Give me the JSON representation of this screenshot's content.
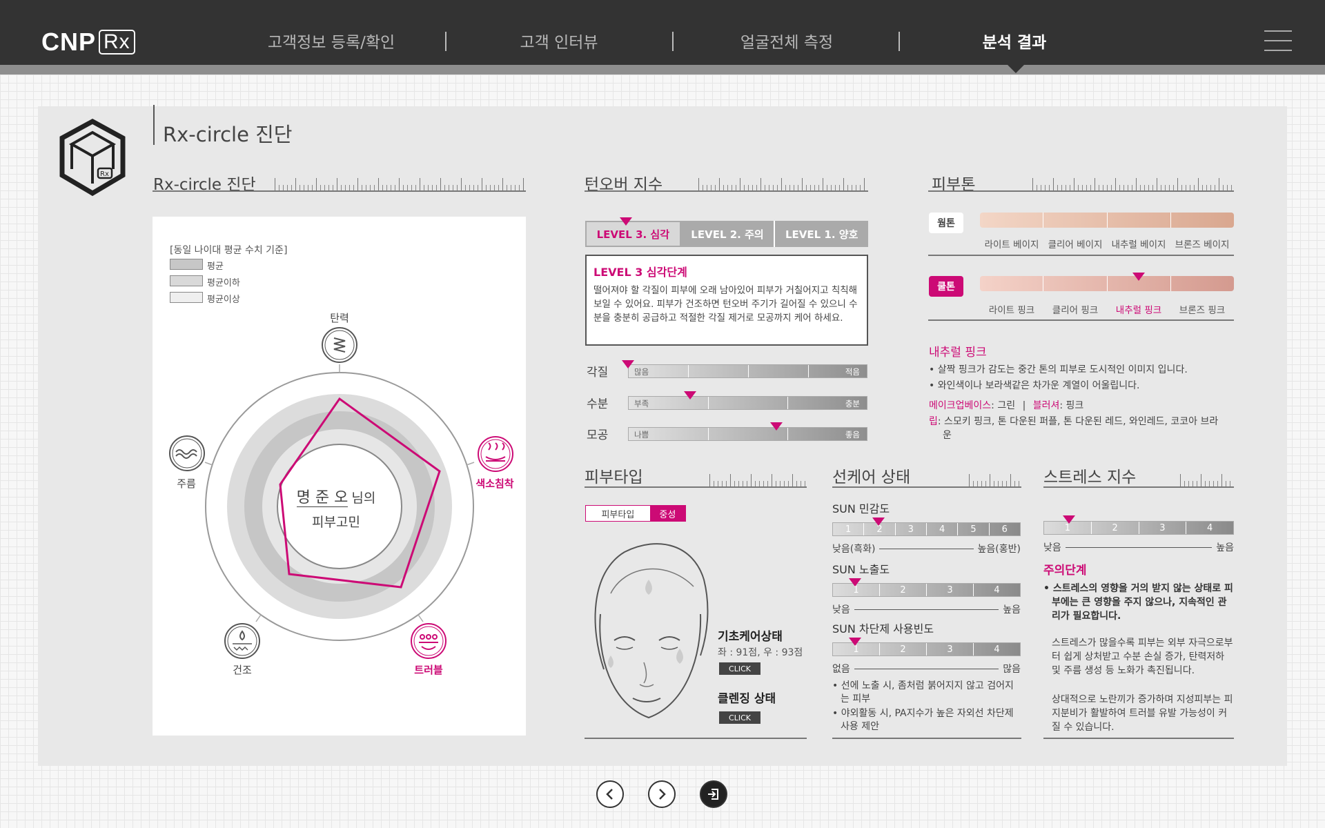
{
  "header": {
    "logo_main": "CNP",
    "logo_sub": "Rx",
    "nav": [
      "고객정보 등록/확인",
      "고객 인터뷰",
      "얼굴전체 측정",
      "분석 결과"
    ],
    "active_nav": "분석 결과"
  },
  "page_title": "Rx-circle 진단",
  "rx_circle": {
    "section_title": "Rx-circle 진단",
    "legend_title": "[동일 나이대 평균 수치 기준]",
    "legend": [
      "평균",
      "평균이하",
      "평균이상"
    ],
    "axes": [
      "탄력",
      "색소침착",
      "트러블",
      "건조",
      "주름"
    ],
    "highlighted_axes": [
      "색소침착",
      "트러블"
    ],
    "center_name": "명 준 오",
    "center_suffix": "님의",
    "center_sub": "피부고민"
  },
  "turnover": {
    "section_title": "턴오버 지수",
    "levels": [
      "LEVEL 3. 심각",
      "LEVEL 2. 주의",
      "LEVEL 1. 양호"
    ],
    "active_level": "LEVEL 3. 심각",
    "box_title": "LEVEL 3 심각단계",
    "box_text": "떨어져야 할 각질이 피부에 오래 남아있어 피부가 거칠어지고 칙칙해 보일 수 있어요. 피부가 건조하면 턴오버 주기가 길어질 수 있으니 수분을 충분히 공급하고 적절한 각질 제거로 모공까지 케어 하세요.",
    "bars": [
      {
        "label": "각질",
        "left": "많음",
        "right": "적음",
        "level": 0.0
      },
      {
        "label": "수분",
        "left": "부족",
        "right": "충분",
        "level": 0.26
      },
      {
        "label": "모공",
        "left": "나쁨",
        "right": "좋음",
        "level": 0.62
      }
    ]
  },
  "skin_tone": {
    "section_title": "피부톤",
    "warm_tag": "웜톤",
    "cool_tag": "쿨톤",
    "warm_labels": [
      "라이트 베이지",
      "클리어 베이지",
      "내추럴 베이지",
      "브론즈 베이지"
    ],
    "cool_labels": [
      "라이트 핑크",
      "클리어 핑크",
      "내추럴 핑크",
      "브론즈 핑크"
    ],
    "selected": "내추럴 핑크",
    "result_title": "내추럴 핑크",
    "bullets": [
      "살짝 핑크가 감도는 중간 톤의 피부로 도시적인 이미지 입니다.",
      "와인색이나 보라색같은 차가운 계열이 어울립니다."
    ],
    "makeup_base_label": "메이크업베이스",
    "makeup_base_value": ": 그린",
    "separator": "|",
    "blusher_label": "블러셔",
    "blusher_value": ": 핑크",
    "lip_label": "립",
    "lip_value": ": 스모키 핑크, 톤 다운된 퍼플, 톤 다운된 레드, 와인레드, 코코아 브라운",
    "colors": {
      "accent": "#cc0a75",
      "warm": [
        "#f3d6c6",
        "#d9a78f"
      ],
      "cool": [
        "#f4d2c8",
        "#d49a8f"
      ]
    }
  },
  "skin_type": {
    "section_title": "피부타입",
    "tab_label": "피부타입",
    "tab_value": "중성",
    "care_title": "기초케어상태",
    "care_scores": "좌 : 91점, 우 : 93점",
    "click_label": "CLICK",
    "cleansing_title": "클렌징 상태"
  },
  "suncare": {
    "section_title": "선케어 상태",
    "sensitivity_title": "SUN 민감도",
    "sensitivity_scale": [
      "1",
      "2",
      "3",
      "4",
      "5",
      "6"
    ],
    "sensitivity_value": 2,
    "sensitivity_low": "낮음(흑화)",
    "sensitivity_high": "높음(홍반)",
    "exposure_title": "SUN 노출도",
    "exposure_scale": [
      "1",
      "2",
      "3",
      "4"
    ],
    "exposure_value": 1,
    "exposure_low": "낮음",
    "exposure_high": "높음",
    "usage_title": "SUN 차단제 사용빈도",
    "usage_scale": [
      "1",
      "2",
      "3",
      "4"
    ],
    "usage_value": 1,
    "usage_low": "없음",
    "usage_high": "많음",
    "bullets": [
      "선에 노출 시, 좀처럼 붉어지지 않고 검어지는 피부",
      "야외활동 시, PA지수가 높은 자외선 차단제 사용 제안"
    ]
  },
  "stress": {
    "section_title": "스트레스 지수",
    "scale": [
      "1",
      "2",
      "3",
      "4"
    ],
    "value": 1,
    "low": "낮음",
    "high": "높음",
    "result_title": "주의단계",
    "bullet": "스트레스의 영향을 거의 받지 않는 상태로 피부에는 큰 영향을 주지 않으나, 지속적인 관리가 필요합니다.",
    "paragraph1": "스트레스가 많을수록 피부는 외부 자극으로부터 쉽게 상처받고 수분 손실 증가, 탄력저하 및 주름 생성 등 노화가 촉진됩니다.",
    "paragraph2": "상대적으로 노란끼가 증가하며 지성피부는 피지분비가 활발하여 트러블 유발 가능성이 커질 수 있습니다."
  },
  "footer": {
    "prev_icon": "chevron-left-icon",
    "next_icon": "chevron-right-icon",
    "exit_icon": "exit-icon"
  }
}
